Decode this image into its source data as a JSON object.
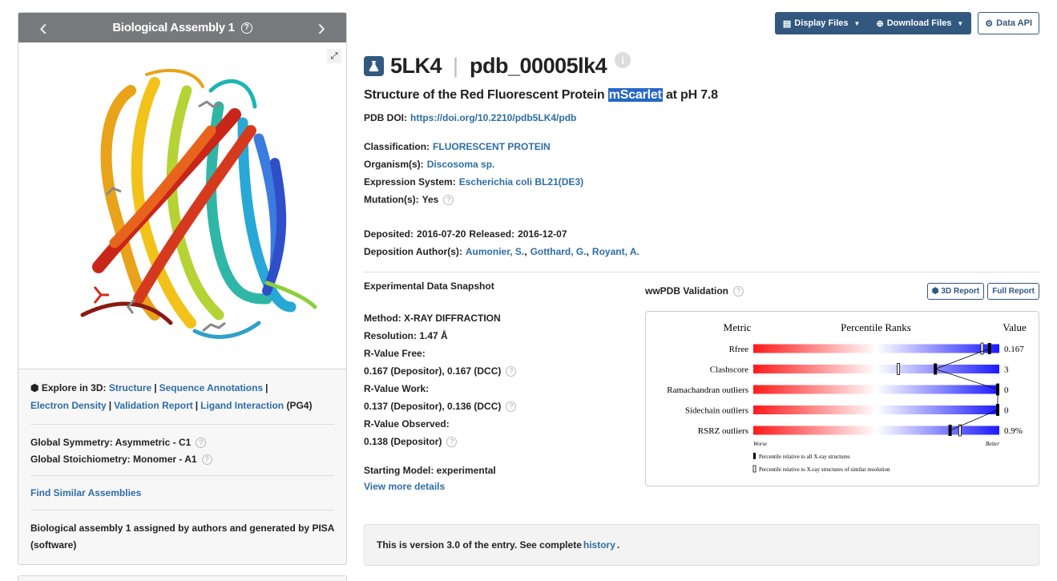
{
  "assembly": {
    "title": "Biological Assembly 1",
    "explore_label": "Explore in 3D:",
    "links": {
      "structure": "Structure",
      "sequence": "Sequence Annotations",
      "density": "Electron Density",
      "validation": "Validation Report",
      "ligand": "Ligand Interaction",
      "ligand_code": "(PG4)"
    },
    "symmetry_label": "Global Symmetry:",
    "symmetry_value": "Asymmetric - C1",
    "stoichiometry_label": "Global Stoichiometry:",
    "stoichiometry_value": "Monomer - A1",
    "find_similar": "Find Similar Assemblies",
    "note": "Biological assembly 1 assigned by authors and generated by PISA (software)"
  },
  "toolbar": {
    "display_files": "Display Files",
    "download_files": "Download Files",
    "data_api": "Data API"
  },
  "entry": {
    "id": "5LK4",
    "pdb_id": "pdb_00005lk4",
    "title_before": "Structure of the Red Fluorescent Protein ",
    "title_highlight": "mScarlet",
    "title_after": " at pH 7.8",
    "doi_label": "PDB DOI:",
    "doi": "https://doi.org/10.2210/pdb5LK4/pdb",
    "classification_label": "Classification:",
    "classification": "FLUORESCENT PROTEIN",
    "organism_label": "Organism(s):",
    "organism": "Discosoma sp.",
    "expression_label": "Expression System:",
    "expression": "Escherichia coli BL21(DE3)",
    "mutation_label": "Mutation(s):",
    "mutation": "Yes",
    "deposited_label": "Deposited:",
    "deposited": "2016-07-20",
    "released_label": "Released:",
    "released": "2016-12-07",
    "authors_label": "Deposition Author(s):",
    "authors": [
      "Aumonier, S.",
      "Gotthard, G.",
      "Royant, A."
    ]
  },
  "snapshot": {
    "title": "Experimental Data Snapshot",
    "method": "Method: X-RAY DIFFRACTION",
    "resolution": "Resolution: 1.47 Å",
    "rfree_label": "R-Value Free:",
    "rfree": "0.167 (Depositor), 0.167 (DCC)",
    "rwork_label": "R-Value Work:",
    "rwork": "0.137 (Depositor), 0.136 (DCC)",
    "robs_label": "R-Value Observed:",
    "robs": "0.138 (Depositor)",
    "starting_model": "Starting Model: experimental",
    "view_more": "View more details"
  },
  "validation": {
    "title": "wwPDB Validation",
    "btn_3d": "3D Report",
    "btn_full": "Full Report",
    "header_metric": "Metric",
    "header_ranks": "Percentile Ranks",
    "header_value": "Value",
    "metrics": [
      {
        "name": "Rfree",
        "value": "0.167",
        "pct_all": 0.96,
        "pct_res": 0.93
      },
      {
        "name": "Clashscore",
        "value": "3",
        "pct_all": 0.74,
        "pct_res": 0.59
      },
      {
        "name": "Ramachandran outliers",
        "value": "0",
        "pct_all": 1.0,
        "pct_res": 1.0
      },
      {
        "name": "Sidechain outliers",
        "value": "0",
        "pct_all": 1.0,
        "pct_res": 1.0
      },
      {
        "name": "RSRZ outliers",
        "value": "0.9%",
        "pct_all": 0.8,
        "pct_res": 0.84
      }
    ],
    "worse": "Worse",
    "better": "Better",
    "legend_all": "Percentile relative to all X-ray structures",
    "legend_res": "Percentile relative to X-ray structures of similar resolution"
  },
  "version": {
    "before": "This is version 3.0 of the entry. See complete",
    "link": "history",
    "after": "."
  },
  "colors": {
    "header_gray": "#777a7d",
    "brand_blue": "#325880",
    "link_blue": "#2e6da4"
  }
}
